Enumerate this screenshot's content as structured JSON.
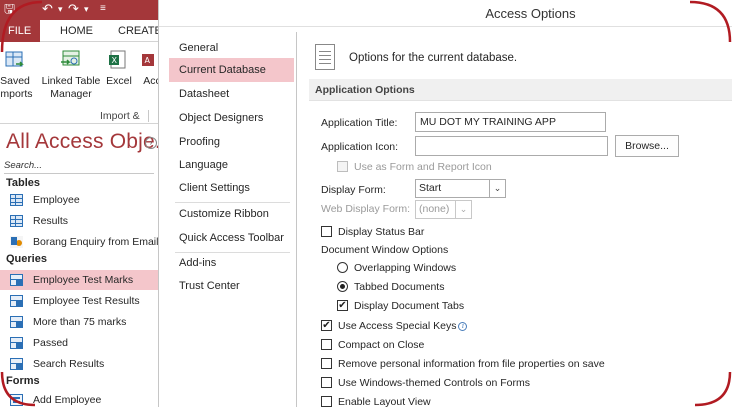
{
  "app": {
    "tabs": {
      "file": "FILE",
      "home": "HOME",
      "create": "CREATE"
    },
    "ribbon": {
      "saved_imports_l1": "Saved",
      "saved_imports_l2": "Imports",
      "linked_table_l1": "Linked Table",
      "linked_table_l2": "Manager",
      "excel": "Excel",
      "access": "Acc",
      "group_label": "Import &"
    },
    "nav": {
      "title": "All Access Obje...",
      "search_placeholder": "Search...",
      "sections": {
        "tables": "Tables",
        "queries": "Queries",
        "forms": "Forms"
      },
      "tables": [
        "Employee",
        "Results",
        "Borang Enquiry from Email"
      ],
      "queries": [
        "Employee Test Marks",
        "Employee Test Results",
        "More than 75 marks",
        "Passed",
        "Search Results"
      ],
      "forms": [
        "Add Employee"
      ],
      "selected_query": "Employee Test Marks"
    }
  },
  "dialog": {
    "title": "Access Options",
    "categories": [
      "General",
      "Current Database",
      "Datasheet",
      "Object Designers",
      "Proofing",
      "Language",
      "Client Settings",
      "Customize Ribbon",
      "Quick Access Toolbar",
      "Add-ins",
      "Trust Center"
    ],
    "selected_category": "Current Database",
    "heading": "Options for the current database.",
    "section_title": "Application Options",
    "fields": {
      "app_title_label": "Application Title:",
      "app_title_value": "MU DOT MY TRAINING APP",
      "app_icon_label": "Application Icon:",
      "app_icon_value": "",
      "browse_button": "Browse...",
      "use_as_icon_label": "Use as Form and Report Icon",
      "display_form_label": "Display Form:",
      "display_form_value": "Start",
      "web_display_form_label": "Web Display Form:",
      "web_display_form_value": "(none)",
      "display_status_bar_label": "Display Status Bar",
      "doc_window_options_label": "Document Window Options",
      "overlapping_windows_label": "Overlapping Windows",
      "tabbed_documents_label": "Tabbed Documents",
      "display_document_tabs_label": "Display Document Tabs",
      "use_access_special_keys_label": "Use Access Special Keys",
      "compact_on_close_label": "Compact on Close",
      "remove_personal_info_label": "Remove personal information from file properties on save",
      "windows_themed_controls_label": "Use Windows-themed Controls on Forms",
      "enable_layout_view_label": "Enable Layout View"
    },
    "states": {
      "use_as_icon": false,
      "display_status_bar": false,
      "overlapping_windows": false,
      "tabbed_documents": true,
      "display_document_tabs": true,
      "use_access_special_keys": true,
      "compact_on_close": false,
      "remove_personal_info": false,
      "windows_themed_controls": false,
      "enable_layout_view": false
    }
  },
  "colors": {
    "access_brand": "#a4373a",
    "selection": "#f4c6cb",
    "frame_accent": "#b11b22"
  }
}
